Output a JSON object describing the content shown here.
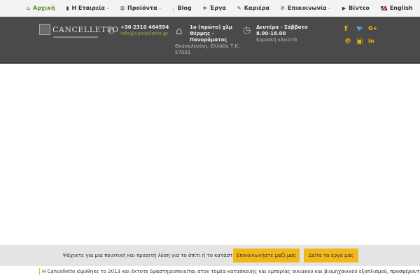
{
  "nav": {
    "items": [
      {
        "label": "Αρχική",
        "icon": "home-icon",
        "glyph": "⌂",
        "active": true,
        "dropdown": false
      },
      {
        "label": "Η Εταιρεία",
        "icon": "book-icon",
        "glyph": "▮",
        "active": false,
        "dropdown": true
      },
      {
        "label": "Προϊόντα",
        "icon": "cart-icon",
        "glyph": "⊡",
        "active": false,
        "dropdown": true
      },
      {
        "label": "Blog",
        "icon": "rss-icon",
        "glyph": "◟",
        "active": false,
        "dropdown": false
      },
      {
        "label": "Έργα",
        "icon": "gear-icon",
        "glyph": "✲",
        "active": false,
        "dropdown": false
      },
      {
        "label": "Καριέρα",
        "icon": "pencil-icon",
        "glyph": "✎",
        "active": false,
        "dropdown": false
      },
      {
        "label": "Επικοινωνία",
        "icon": "phone-icon",
        "glyph": "✆",
        "active": false,
        "dropdown": true
      },
      {
        "label": "Βίντεο",
        "icon": "youtube-icon",
        "glyph": "▶",
        "active": false,
        "dropdown": false
      },
      {
        "label": "English",
        "icon": "uk-flag-icon",
        "glyph": "",
        "active": false,
        "dropdown": false
      }
    ],
    "caret_glyph": "⌄"
  },
  "header": {
    "logo_text": "CANCELLETTO",
    "phone": "+30 2310 464594",
    "email": "info@cancelletto.gr",
    "address_line1": "1ο (πρώτο) χλμ",
    "address_line2": "Θέρμης -",
    "address_line3": "Πανοράματος",
    "address_line4": "Θεσσαλονίκη, Ελλάδα Τ.Κ.",
    "address_line5": "57001",
    "hours_line1": "Δευτέρα - Σάββατο",
    "hours_line2": "8.00-18.00",
    "hours_line3": "Κυριακή κλειστά"
  },
  "social": [
    {
      "name": "facebook-icon",
      "glyph": "f"
    },
    {
      "name": "twitter-icon",
      "glyph": "🐦"
    },
    {
      "name": "google-plus-icon",
      "glyph": "G+"
    },
    {
      "name": "pinterest-icon",
      "glyph": "℗"
    },
    {
      "name": "youtube-icon",
      "glyph": "▣"
    },
    {
      "name": "linkedin-icon",
      "glyph": "in"
    }
  ],
  "cta": {
    "text": "Ψάχνετε για μια ποιοτική και προσιτή λύση για το σπίτι ή το κατάστημα σας;",
    "contact_button": "Επικοινωνήστε μαζί μας",
    "projects_button": "Δείτε τα έργα μας"
  },
  "intro": {
    "line1": "Η Cancelletto ιδρύθηκε το 2013 και έκτοτε δραστηριοποιείται στον τομέα κατασκευής και εμπορίας οικιακού και βιομηχανικού εξοπλισμού, προσφέροντας"
  }
}
